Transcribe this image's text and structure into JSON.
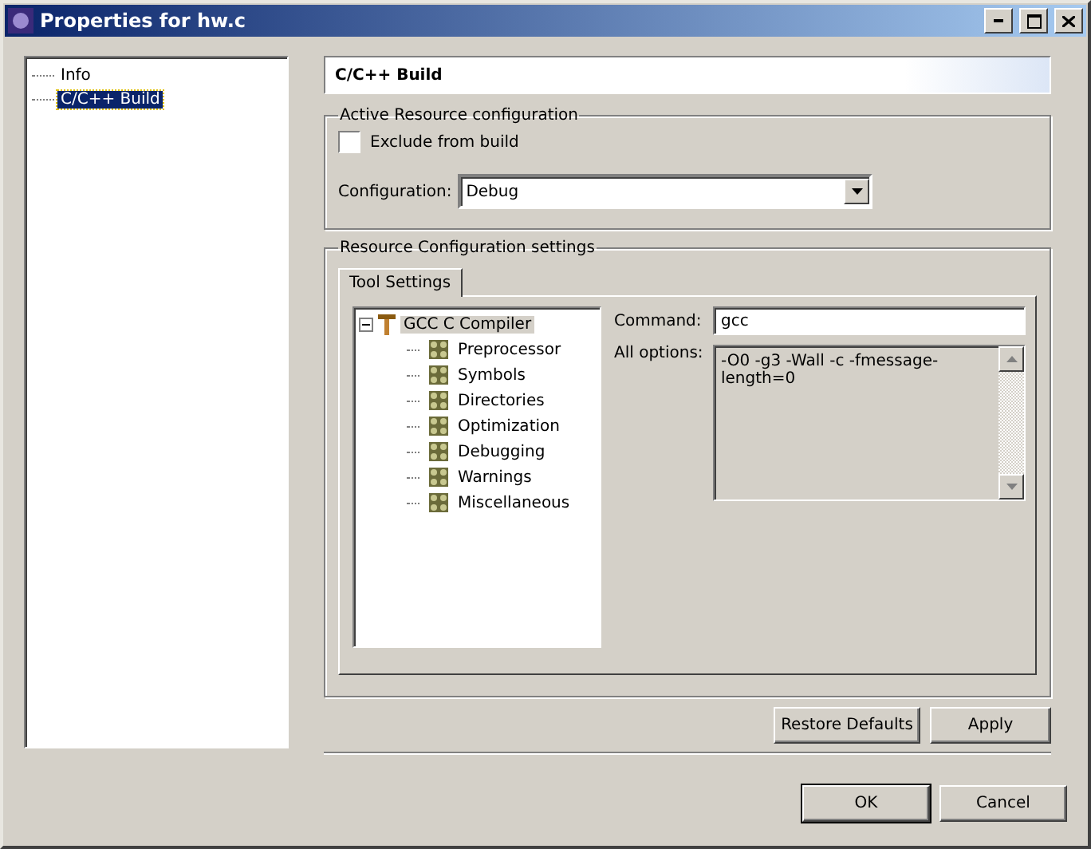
{
  "window": {
    "title": "Properties for hw.c"
  },
  "nav_tree": [
    {
      "label": "Info",
      "selected": false
    },
    {
      "label": "C/C++ Build",
      "selected": true
    }
  ],
  "page_title": "C/C++ Build",
  "active_group": {
    "title": "Active Resource configuration",
    "exclude": {
      "label": "Exclude from build",
      "checked": false
    },
    "configuration": {
      "label": "Configuration:",
      "value": "Debug"
    }
  },
  "settings_group": {
    "title": "Resource Configuration settings",
    "tabs": [
      {
        "label": "Tool Settings",
        "selected": true
      }
    ],
    "tool_tree": {
      "label": "GCC C Compiler",
      "expanded": true,
      "selected": true,
      "children": [
        {
          "label": "Preprocessor"
        },
        {
          "label": "Symbols"
        },
        {
          "label": "Directories"
        },
        {
          "label": "Optimization"
        },
        {
          "label": "Debugging"
        },
        {
          "label": "Warnings"
        },
        {
          "label": "Miscellaneous"
        }
      ]
    },
    "command": {
      "label": "Command:",
      "value": "gcc"
    },
    "all_options": {
      "label": "All options:",
      "value": "-O0 -g3 -Wall -c -fmessage-length=0"
    }
  },
  "page_buttons": [
    "Restore Defaults",
    "Apply"
  ],
  "dialog_buttons": [
    "OK",
    "Cancel"
  ]
}
